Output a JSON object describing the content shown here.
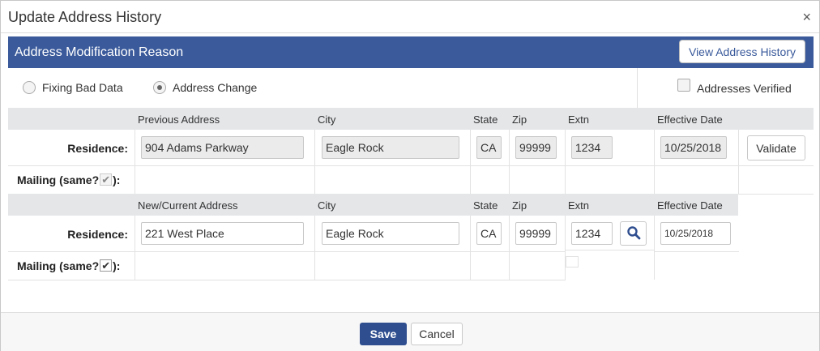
{
  "dialog": {
    "title": "Update Address History",
    "close_glyph": "×"
  },
  "banner": {
    "title": "Address Modification Reason",
    "view_history_label": "View Address History"
  },
  "reason": {
    "option_fixing": "Fixing Bad Data",
    "option_change": "Address Change",
    "selected": "Address Change",
    "verified_label": "Addresses Verified",
    "verified_checked": false
  },
  "previous": {
    "headers": {
      "address": "Previous Address",
      "city": "City",
      "state": "State",
      "zip": "Zip",
      "extn": "Extn",
      "effective_date": "Effective Date"
    },
    "residence_label": "Residence:",
    "residence": {
      "address": "904 Adams Parkway",
      "city": "Eagle Rock",
      "state": "CA",
      "zip": "99999",
      "extn": "1234",
      "effective_date": "10/25/2018"
    },
    "validate_label": "Validate",
    "mailing_label_pre": "Mailing (same?",
    "mailing_label_post": "):",
    "mailing_same_checked": true
  },
  "current": {
    "headers": {
      "address": "New/Current Address",
      "city": "City",
      "state": "State",
      "zip": "Zip",
      "extn": "Extn",
      "effective_date": "Effective Date"
    },
    "residence_label": "Residence:",
    "residence": {
      "address": "221 West Place",
      "city": "Eagle Rock",
      "state": "CA",
      "zip": "99999",
      "extn": "1234",
      "effective_date": "10/25/2018"
    },
    "mailing_label_pre": "Mailing (same?",
    "mailing_label_post": "):",
    "mailing_same_checked": true
  },
  "footer": {
    "save_label": "Save",
    "cancel_label": "Cancel"
  },
  "icons": {
    "check": "✔"
  },
  "colors": {
    "banner": "#3a5a9b",
    "save_button": "#2f4e8f",
    "header_row": "#e4e6e8"
  }
}
